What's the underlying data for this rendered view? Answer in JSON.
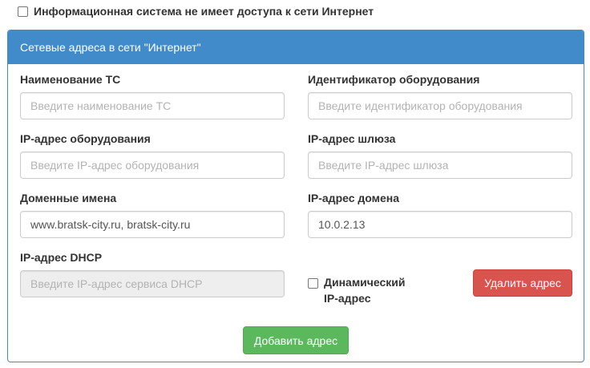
{
  "no_internet_checkbox": {
    "label": "Информационная система не имеет доступа к сети Интернет"
  },
  "panel": {
    "title": "Сетевые адреса в сети \"Интернет\"",
    "fields": {
      "ts_name": {
        "label": "Наименование ТС",
        "value": "",
        "placeholder": "Введите наименование ТС"
      },
      "equipment_id": {
        "label": "Идентификатор оборудования",
        "value": "",
        "placeholder": "Введите идентификатор оборудования"
      },
      "equipment_ip": {
        "label": "IP-адрес оборудования",
        "value": "",
        "placeholder": "Введите IP-адрес оборудования"
      },
      "gateway_ip": {
        "label": "IP-адрес шлюза",
        "value": "",
        "placeholder": "Введите IP-адрес шлюза"
      },
      "domain_names": {
        "label": "Доменные имена",
        "value": "www.bratsk-city.ru, bratsk-city.ru",
        "placeholder": ""
      },
      "domain_ip": {
        "label": "IP-адрес домена",
        "value": "10.0.2.13",
        "placeholder": ""
      },
      "dhcp_ip": {
        "label": "IP-адрес DHCP",
        "value": "",
        "placeholder": "Введите IP-адрес сервиса DHCP"
      }
    },
    "dynamic_ip_checkbox": {
      "label": "Динамический IP-адрес"
    },
    "delete_button": "Удалить адрес",
    "add_button": "Добавить адрес"
  }
}
